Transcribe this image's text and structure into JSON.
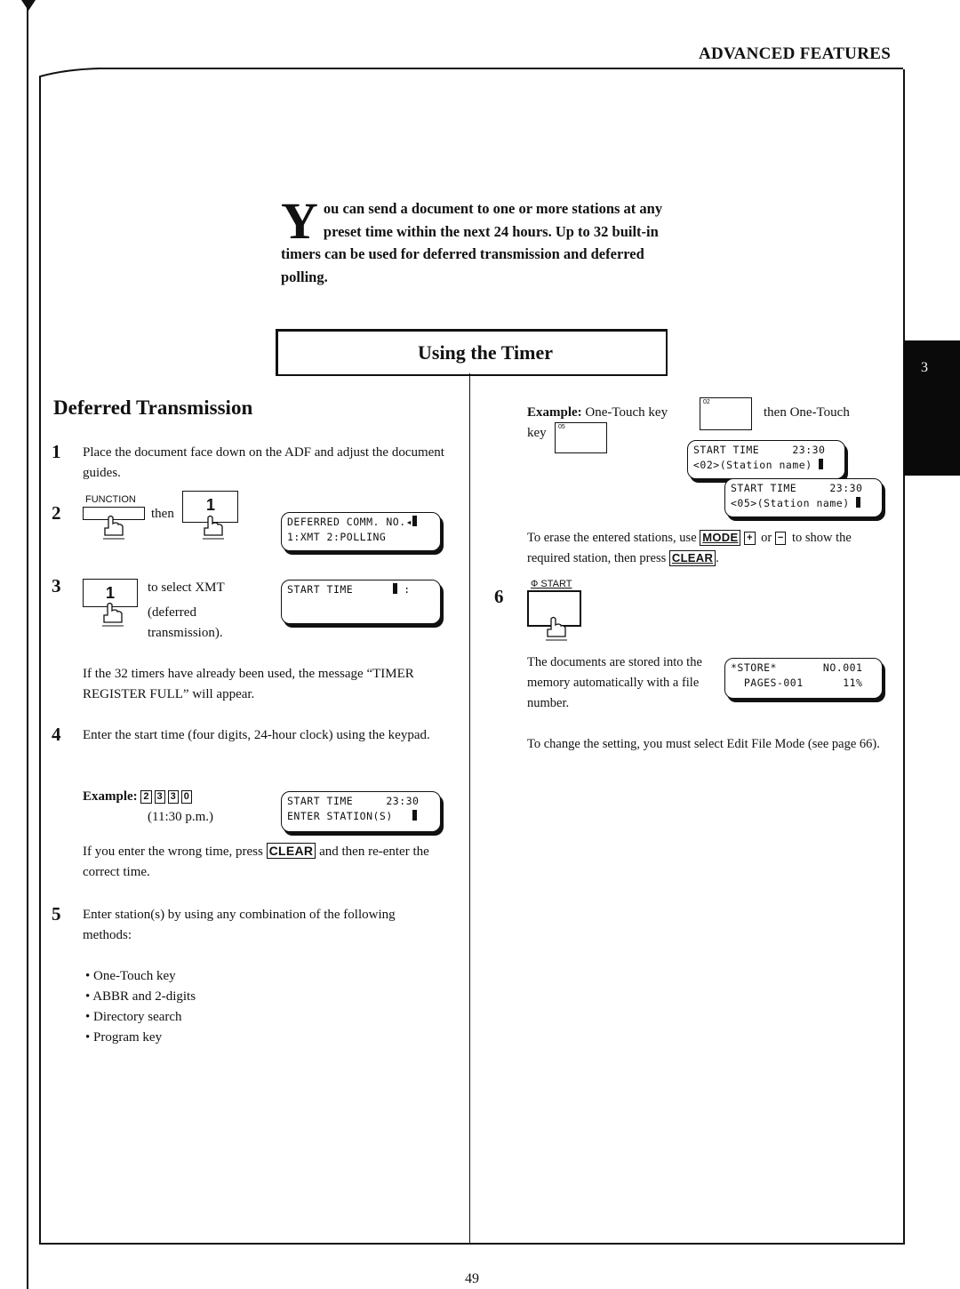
{
  "header": {
    "section": "ADVANCED FEATURES",
    "chapter_tab": "3"
  },
  "intro": {
    "dropcap": "Y",
    "text": "ou can send a document to one or more stations at any preset time within the next 24 hours.  Up to 32 built-in timers can be used for deferred transmission and deferred polling."
  },
  "title": "Using the Timer",
  "left": {
    "heading": "Deferred Transmission",
    "step1": {
      "num": "1",
      "text": "Place the document face down on the ADF and adjust the document guides."
    },
    "step2": {
      "num": "2",
      "key1_label": "FUNCTION",
      "then": "then",
      "key2_label": "1",
      "lcd_line1": "DEFERRED COMM. NO.",
      "lcd_line2": "1:XMT 2:POLLING"
    },
    "step3": {
      "num": "3",
      "key_label": "1",
      "text1": "to select XMT",
      "text2": "(deferred",
      "text3": "transmission).",
      "lcd_line1": "START TIME      ",
      "lcd_line1_tail": " :",
      "lcd_line2": ""
    },
    "note3": "If the 32 timers have already been used, the message “TIMER REGISTER FULL” will appear.",
    "step4": {
      "num": "4",
      "text": "Enter the start time (four digits, 24-hour clock) using the keypad.",
      "example_label": "Example:",
      "digits": [
        "2",
        "3",
        "3",
        "0"
      ],
      "example_time": "(11:30 p.m.)",
      "lcd_line1": "START TIME     23:30",
      "lcd_line2": "ENTER STATION(S)   "
    },
    "note4_before": "If you enter the wrong time, press ",
    "note4_key": "CLEAR",
    "note4_after": " and then re-enter the correct time.",
    "step5": {
      "num": "5",
      "text": "Enter station(s) by using any combination of the following methods:",
      "methods": [
        "One-Touch key",
        "ABBR and 2-digits",
        "Directory search",
        "Program key"
      ]
    }
  },
  "right": {
    "example_label": "Example:",
    "example_text1": "One-Touch key",
    "key_a": "02",
    "example_text2": "then One-Touch",
    "example_text3": "key",
    "key_b": "05",
    "lcd_a_line1": "START TIME     23:30",
    "lcd_a_line2": "<02>(Station name) ",
    "lcd_b_line1": "START TIME     23:30",
    "lcd_b_line2": "<05>(Station name) ",
    "erase_before": "To erase the entered stations, use ",
    "erase_key_mode": "MODE",
    "erase_key_plus": "+",
    "erase_or": " or ",
    "erase_key_minus": "−",
    "erase_mid": " to show the required station, then press ",
    "erase_key_clear": "CLEAR",
    "erase_end": ".",
    "step6": {
      "num": "6",
      "key_label": "Ф START",
      "text": "The documents are stored into the memory automatically with a file number.",
      "lcd_line1": "*STORE*       NO.001",
      "lcd_line2": "  PAGES-001      11%"
    },
    "change_note": "To change the setting, you must select Edit File Mode (see page 66)."
  },
  "footer": {
    "page_number": "49"
  }
}
